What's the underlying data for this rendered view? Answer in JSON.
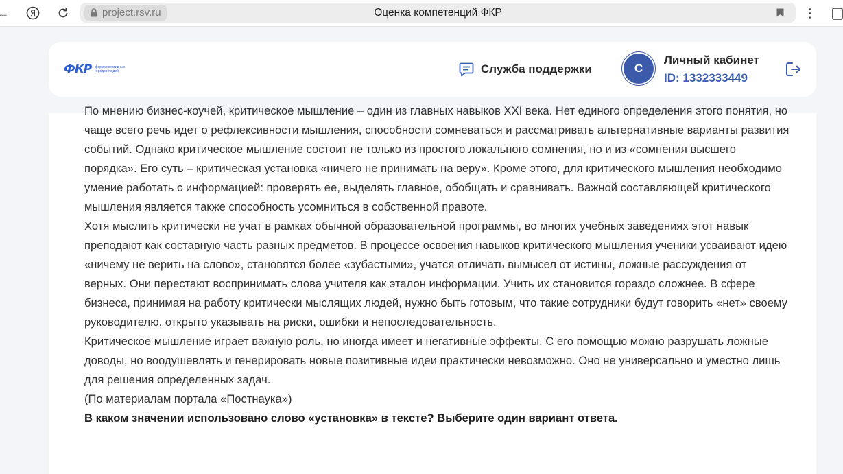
{
  "browser": {
    "url": "project.rsv.ru",
    "title": "Оценка компетенций ФКР"
  },
  "header": {
    "logo_text": "ФКР",
    "logo_subtitle": "форум креативных городов людей",
    "support_label": "Служба поддержки",
    "avatar_letter": "С",
    "account_title": "Личный кабинет",
    "account_id": "ID: 1332333449"
  },
  "article": {
    "paragraphs": [
      "По мнению бизнес-коучей, критическое мышление – один из главных навыков XXI века. Нет единого определения этого понятия, но чаще всего речь идет о рефлексивности мышления, способности сомневаться и рассматривать альтернативные варианты развития событий. Однако критическое мышление состоит не только из простого локального сомнения, но и из «сомнения высшего порядка». Его суть – критическая установка «ничего не принимать на веру». Кроме этого, для критического мышления необходимо умение работать с информацией: проверять ее, выделять главное, обобщать и сравнивать. Важной составляющей критического мышления является также способность усомниться в собственной правоте.",
      "Хотя мыслить критически не учат в рамках обычной образовательной программы, во многих учебных заведениях этот навык преподают как составную часть разных предметов. В процессе освоения навыков критического мышления ученики усваивают идею «ничему не верить на слово», становятся более «зубастыми», учатся отличать вымысел от истины, ложные рассуждения от верных. Они перестают воспринимать слова учителя как эталон информации. Учить их становится гораздо сложнее. В сфере бизнеса, принимая на работу критически мыслящих людей, нужно быть готовым, что такие сотрудники будут говорить «нет» своему руководителю, открыто указывать на риски, ошибки и непоследовательность.",
      "Критическое мышление играет важную роль, но иногда имеет и негативные эффекты. С его помощью можно разрушать ложные доводы, но воодушевлять и генерировать новые позитивные идеи практически невозможно. Оно не универсально и уместно лишь для решения определенных задач.",
      "(По материалам портала «Постнаука»)"
    ],
    "question": "В каком значении использовано слово «установка» в тексте? Выберите один вариант ответа."
  },
  "colors": {
    "brand_blue": "#3b5fae",
    "page_bg": "#f3f5f8"
  }
}
